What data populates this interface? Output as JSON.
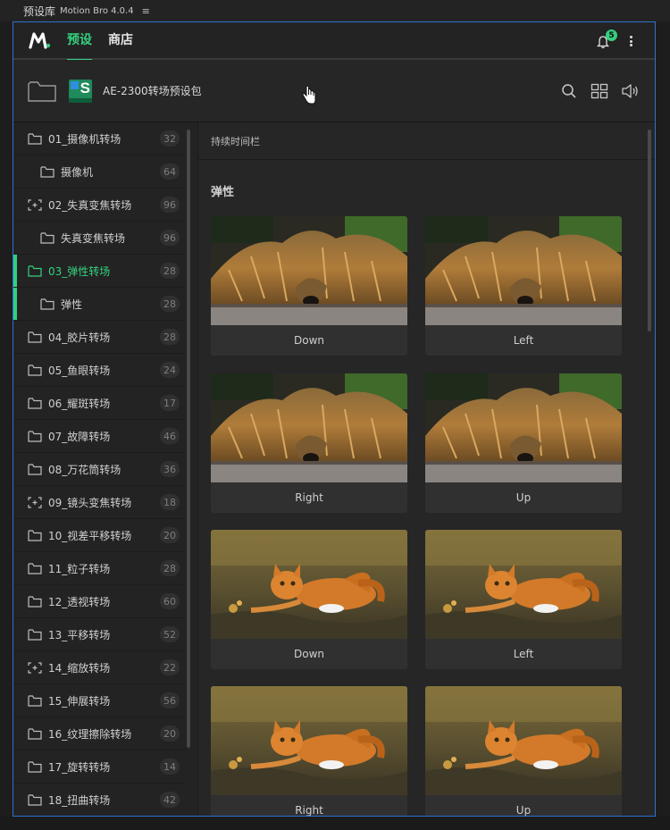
{
  "window": {
    "title": "预设库",
    "version": "Motion Bro 4.0.4",
    "menu_icon": "hamburger-icon"
  },
  "topnav": {
    "logo": "motion-bro-logo",
    "tabs": [
      {
        "label": "预设",
        "active": true
      },
      {
        "label": "商店",
        "active": false
      }
    ],
    "notification_count": "5"
  },
  "toolbar": {
    "pack_name": "AE-2300转场预设包",
    "tools": [
      "search-icon",
      "grid-view-icon",
      "volume-icon"
    ]
  },
  "sidebar": {
    "items": [
      {
        "label": "01_摄像机转场",
        "count": "32",
        "icon": "folder-icon"
      },
      {
        "label": "摄像机",
        "count": "64",
        "icon": "folder-icon",
        "sub": true
      },
      {
        "label": "02_失真变焦转场",
        "count": "96",
        "icon": "focus-folder-icon"
      },
      {
        "label": "失真变焦转场",
        "count": "96",
        "icon": "folder-icon",
        "sub": true
      },
      {
        "label": "03_弹性转场",
        "count": "28",
        "icon": "folder-icon",
        "active": true
      },
      {
        "label": "弹性",
        "count": "28",
        "icon": "folder-icon",
        "sub": true
      },
      {
        "label": "04_胶片转场",
        "count": "28",
        "icon": "folder-icon"
      },
      {
        "label": "05_鱼眼转场",
        "count": "24",
        "icon": "folder-icon"
      },
      {
        "label": "06_耀斑转场",
        "count": "17",
        "icon": "folder-icon"
      },
      {
        "label": "07_故障转场",
        "count": "46",
        "icon": "folder-icon"
      },
      {
        "label": "08_万花筒转场",
        "count": "36",
        "icon": "folder-icon"
      },
      {
        "label": "09_镜头变焦转场",
        "count": "18",
        "icon": "focus-folder-icon"
      },
      {
        "label": "10_视差平移转场",
        "count": "20",
        "icon": "folder-icon"
      },
      {
        "label": "11_粒子转场",
        "count": "28",
        "icon": "folder-icon"
      },
      {
        "label": "12_透视转场",
        "count": "60",
        "icon": "folder-icon"
      },
      {
        "label": "13_平移转场",
        "count": "52",
        "icon": "folder-icon"
      },
      {
        "label": "14_缩放转场",
        "count": "22",
        "icon": "focus-folder-icon"
      },
      {
        "label": "15_伸展转场",
        "count": "56",
        "icon": "folder-icon"
      },
      {
        "label": "16_纹理擦除转场",
        "count": "20",
        "icon": "folder-icon"
      },
      {
        "label": "17_旋转转场",
        "count": "14",
        "icon": "folder-icon"
      },
      {
        "label": "18_扭曲转场",
        "count": "42",
        "icon": "folder-icon"
      }
    ]
  },
  "content": {
    "duration_label": "持续时间栏",
    "section_title": "弹性",
    "cards": [
      {
        "label": "Down",
        "thumb": "dog"
      },
      {
        "label": "Left",
        "thumb": "dog"
      },
      {
        "label": "Right",
        "thumb": "dog"
      },
      {
        "label": "Up",
        "thumb": "dog"
      },
      {
        "label": "Down",
        "thumb": "cat"
      },
      {
        "label": "Left",
        "thumb": "cat"
      },
      {
        "label": "Right",
        "thumb": "cat"
      },
      {
        "label": "Up",
        "thumb": "cat"
      }
    ]
  },
  "colors": {
    "accent": "#35d07f",
    "panel_border": "#2f6fd1",
    "background": "#232323"
  }
}
